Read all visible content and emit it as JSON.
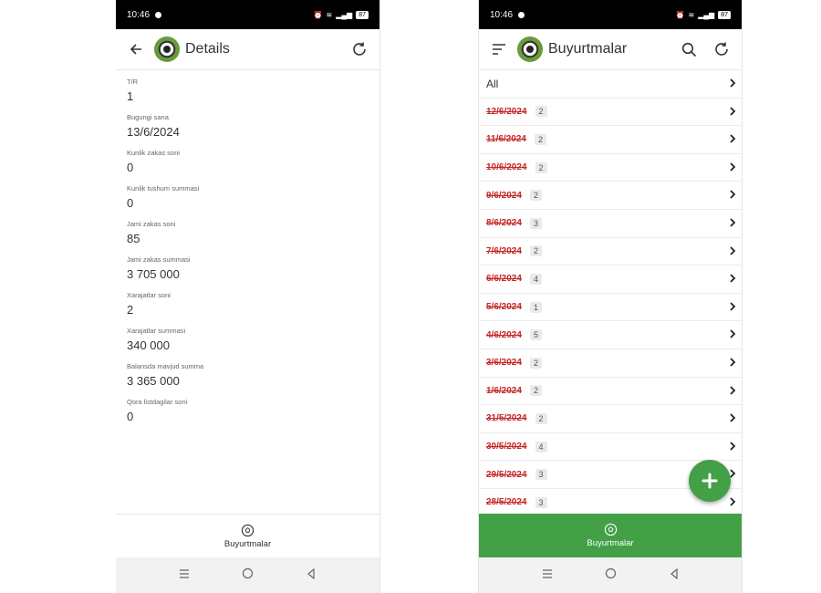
{
  "status_bar": {
    "time": "10:46",
    "battery": "87"
  },
  "details_screen": {
    "title": "Details",
    "fields": [
      {
        "label": "T/R",
        "value": "1"
      },
      {
        "label": "Bugungi sana",
        "value": "13/6/2024"
      },
      {
        "label": "Kunlik zakas soni",
        "value": "0"
      },
      {
        "label": "Kunlik tushum summasi",
        "value": "0"
      },
      {
        "label": "Jami zakas soni",
        "value": "85"
      },
      {
        "label": "Jami zakas summasi",
        "value": "3 705 000"
      },
      {
        "label": "Xarajatlar soni",
        "value": "2"
      },
      {
        "label": "Xarajatlar summasi",
        "value": "340 000"
      },
      {
        "label": "Balansda mavjud summa",
        "value": "3 365 000"
      },
      {
        "label": "Qora listdagilar soni",
        "value": "0"
      }
    ],
    "bottom_nav_label": "Buyurtmalar"
  },
  "orders_screen": {
    "title": "Buyurtmalar",
    "all_label": "All",
    "rows": [
      {
        "date": "12/6/2024",
        "count": "2"
      },
      {
        "date": "11/6/2024",
        "count": "2"
      },
      {
        "date": "10/6/2024",
        "count": "2"
      },
      {
        "date": "9/6/2024",
        "count": "2"
      },
      {
        "date": "8/6/2024",
        "count": "3"
      },
      {
        "date": "7/6/2024",
        "count": "2"
      },
      {
        "date": "6/6/2024",
        "count": "4"
      },
      {
        "date": "5/6/2024",
        "count": "1"
      },
      {
        "date": "4/6/2024",
        "count": "5"
      },
      {
        "date": "3/6/2024",
        "count": "2"
      },
      {
        "date": "1/6/2024",
        "count": "2"
      },
      {
        "date": "31/5/2024",
        "count": "2"
      },
      {
        "date": "30/5/2024",
        "count": "4"
      },
      {
        "date": "29/5/2024",
        "count": "3"
      },
      {
        "date": "28/5/2024",
        "count": "3"
      }
    ],
    "bottom_nav_label": "Buyurtmalar"
  },
  "colors": {
    "accent": "#43a047",
    "date_strike": "#c62828"
  }
}
